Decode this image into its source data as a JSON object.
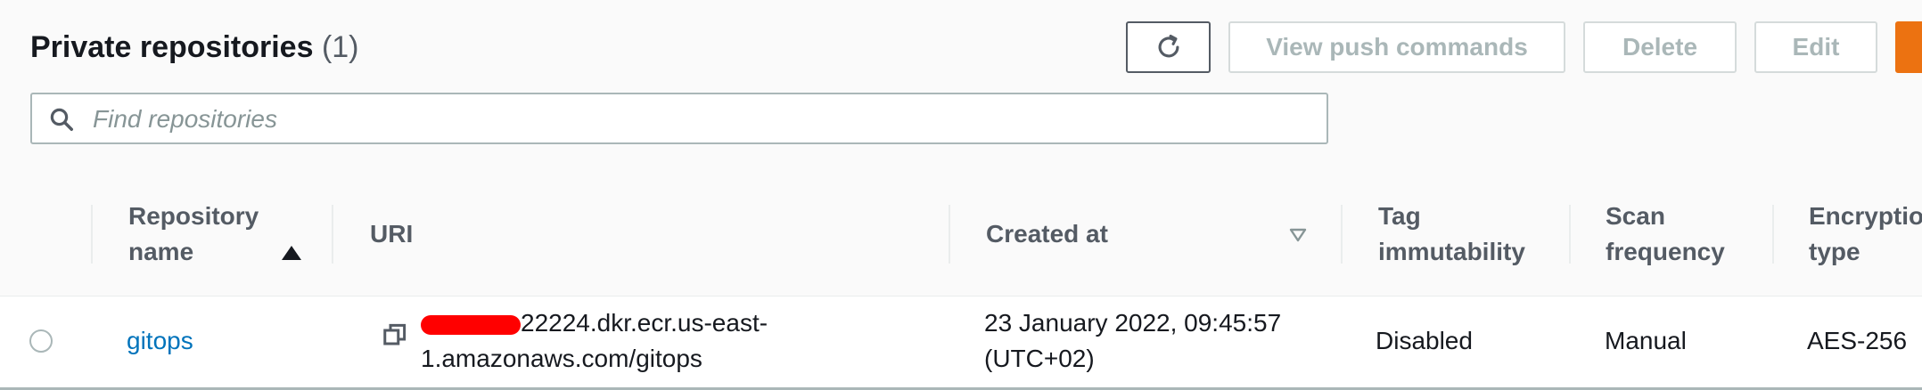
{
  "header": {
    "title": "Private repositories",
    "count": "(1)",
    "buttons": {
      "view_push": "View push commands",
      "delete": "Delete",
      "edit": "Edit"
    },
    "search": {
      "placeholder": "Find repositories"
    }
  },
  "table": {
    "columns": [
      {
        "label": "Repository\nname",
        "sort": "ascending"
      },
      {
        "label": "URI"
      },
      {
        "label": "Created at",
        "sort": "descending"
      },
      {
        "label": "Tag\nimmutability"
      },
      {
        "label": "Scan\nfrequency"
      },
      {
        "label": "Encryption\ntype"
      }
    ],
    "rows": [
      {
        "name": "gitops",
        "uri_visible": "22224.dkr.ecr.us-east-1.amazonaws.com/gitops",
        "created_at_line1": "23 January 2022, 09:45:57",
        "created_at_line2": "(UTC+02)",
        "tag_immutability": "Disabled",
        "scan_frequency": "Manual",
        "encryption_type": "AES-256"
      }
    ]
  },
  "icons": {
    "refresh": "refresh-icon",
    "search": "search-icon",
    "copy": "copy-icon",
    "sort_asc": "sort-ascending-icon",
    "sort_desc": "sort-descending-icon"
  },
  "colors": {
    "primary": "#ec7211",
    "link": "#0073bb",
    "redaction": "#ff0000"
  }
}
